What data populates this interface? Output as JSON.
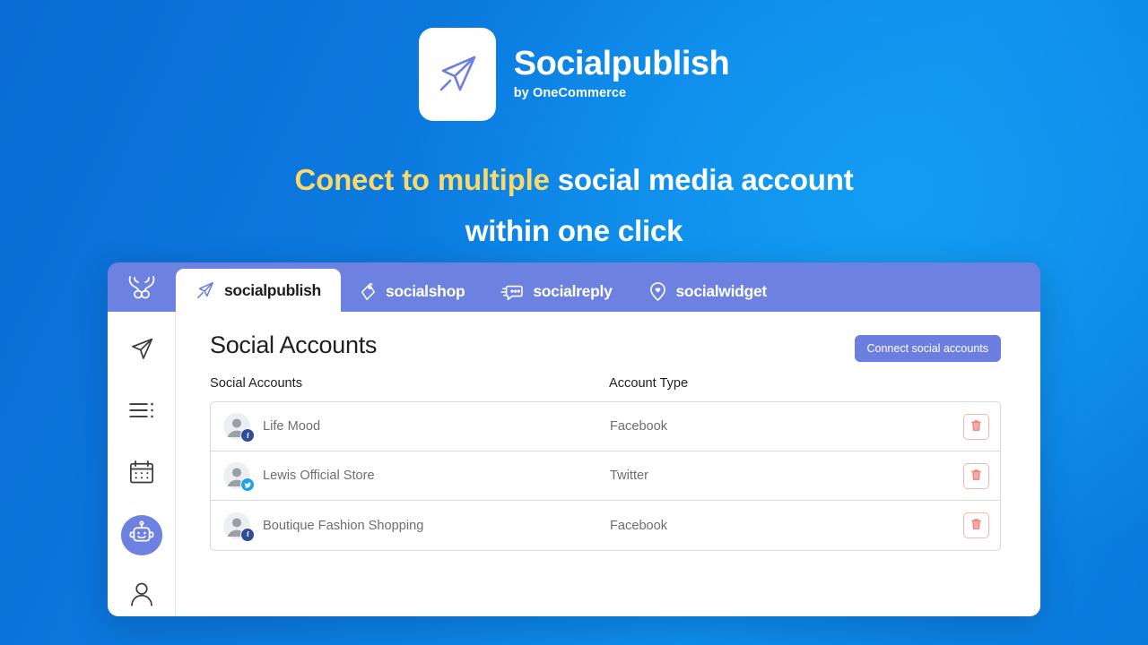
{
  "promo": {
    "logo_icon": "paper-plane-icon",
    "brand_name": "Socialpublish",
    "brand_subtitle": "by OneCommerce",
    "headline_highlight": "Conect to multiple",
    "headline_rest": " social media account",
    "headline_line2": "within one click",
    "highlight_color": "#F9D96A"
  },
  "app": {
    "suite_logo_icon": "antler-logo-icon",
    "accent_color": "#6C81E0",
    "tabs": [
      {
        "label": "socialpublish",
        "icon": "paper-plane-icon",
        "active": true
      },
      {
        "label": "socialshop",
        "icon": "price-tag-icon",
        "active": false
      },
      {
        "label": "socialreply",
        "icon": "chat-bubble-icon",
        "active": false
      },
      {
        "label": "socialwidget",
        "icon": "location-pin-heart-icon",
        "active": false
      }
    ],
    "sidebar": [
      {
        "name": "publish",
        "icon": "paper-plane-icon",
        "active": false
      },
      {
        "name": "queue",
        "icon": "list-icon",
        "active": false
      },
      {
        "name": "calendar",
        "icon": "calendar-icon",
        "active": false
      },
      {
        "name": "automation",
        "icon": "robot-icon",
        "active": true
      },
      {
        "name": "account",
        "icon": "user-icon",
        "active": false
      }
    ],
    "page_title": "Social Accounts",
    "connect_button": "Connect social accounts",
    "columns": {
      "name": "Social Accounts",
      "type": "Account Type"
    },
    "rows": [
      {
        "name": "Life Mood",
        "type": "Facebook",
        "platform": "facebook",
        "delete_icon": "trash-icon"
      },
      {
        "name": "Lewis Official Store",
        "type": "Twitter",
        "platform": "twitter",
        "delete_icon": "trash-icon"
      },
      {
        "name": "Boutique Fashion Shopping",
        "type": "Facebook",
        "platform": "facebook",
        "delete_icon": "trash-icon"
      }
    ]
  }
}
